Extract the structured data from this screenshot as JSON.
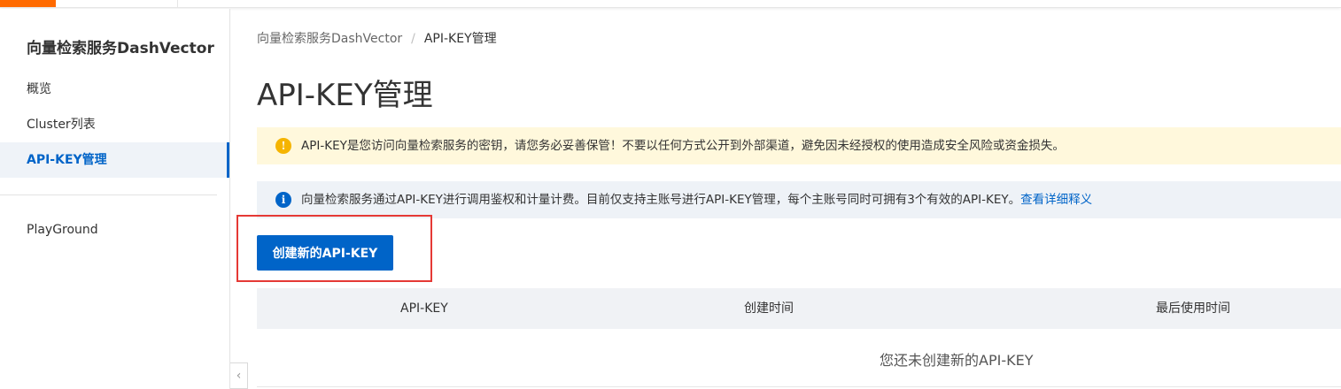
{
  "sidebar": {
    "title": "向量检索服务DashVector",
    "items": [
      {
        "label": "概览"
      },
      {
        "label": "Cluster列表"
      },
      {
        "label": "API-KEY管理"
      },
      {
        "label": "PlayGround"
      }
    ]
  },
  "main": {
    "breadcrumb": [
      "向量检索服务DashVector",
      "API-KEY管理"
    ],
    "breadcrumb_separator": "/",
    "title": "API-KEY管理",
    "warning_alert": {
      "icon": "warning-icon",
      "text": "API-KEY是您访问向量检索服务的密钥，请您务必妥善保管！不要以任何方式公开到外部渠道，避免因未经授权的使用造成安全风险或资金损失。"
    },
    "info_alert": {
      "icon": "info-icon",
      "text": "向量检索服务通过API-KEY进行调用鉴权和计量计费。目前仅支持主账号进行API-KEY管理，每个主账号同时可拥有3个有效的API-KEY。",
      "link": "查看详细释义"
    },
    "create_button": "创建新的API-KEY",
    "table": {
      "columns": [
        "API-KEY",
        "创建时间",
        "最后使用时间"
      ],
      "empty_text": "您还未创建新的API-KEY"
    }
  },
  "colors": {
    "brand": "#ff6a00",
    "primary": "#0064c8",
    "warning": "#f5b400",
    "highlight": "#e53935"
  }
}
